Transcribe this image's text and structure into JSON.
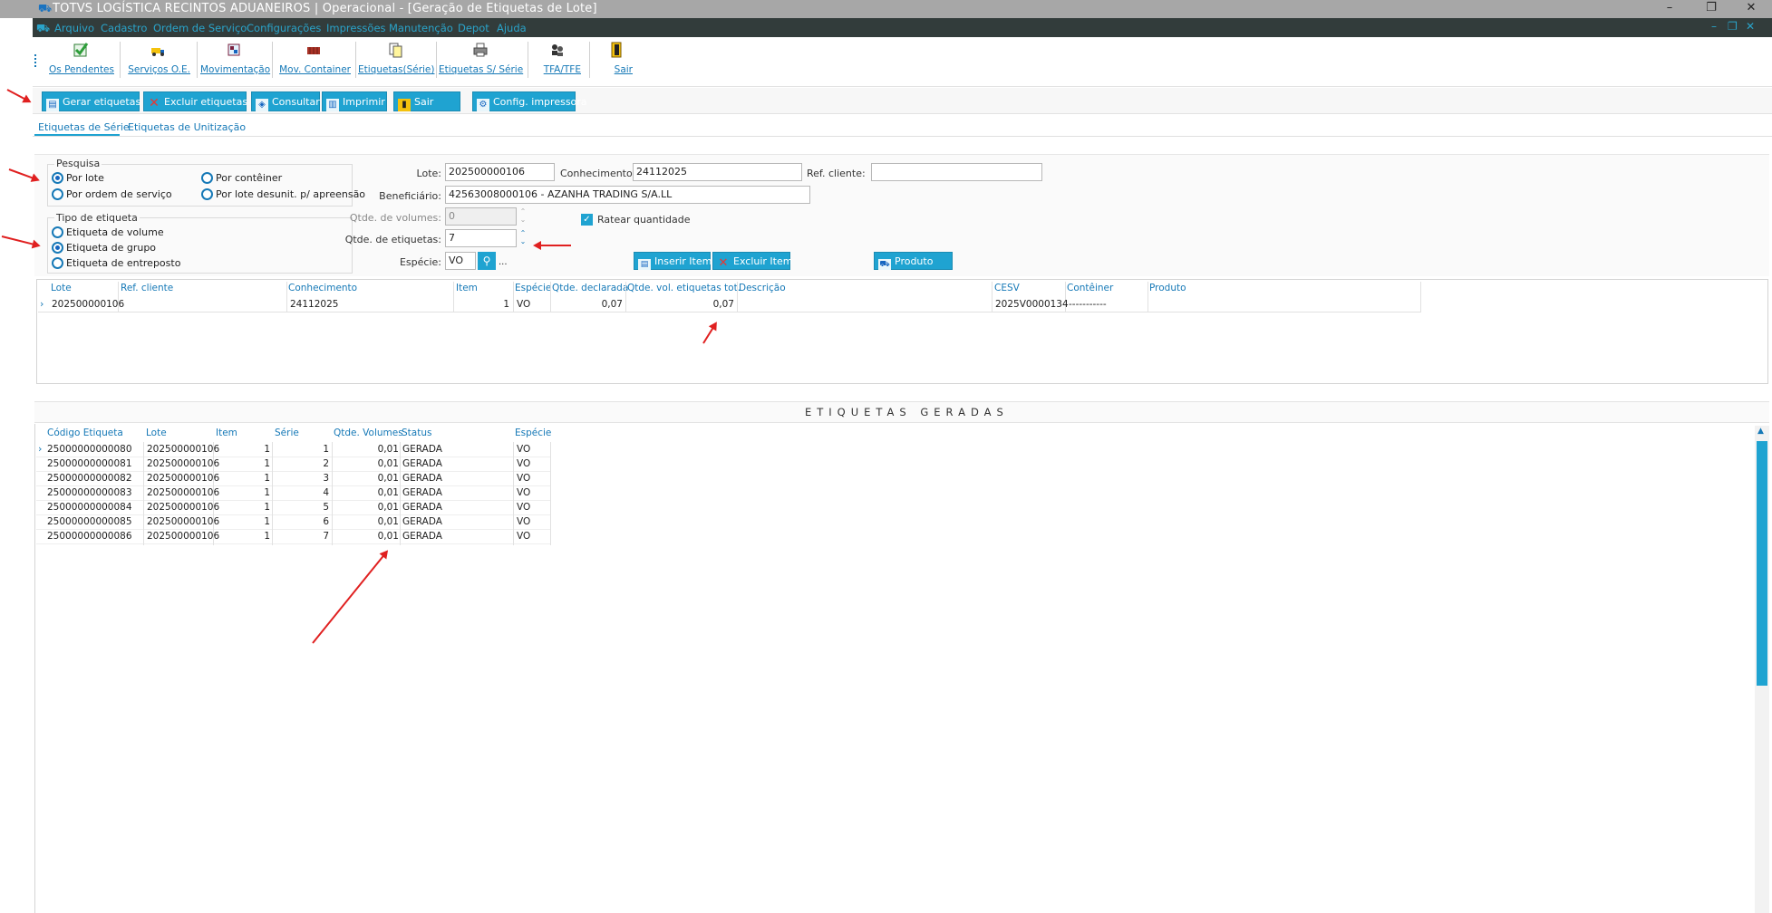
{
  "window": {
    "title": "TOTVS LOGÍSTICA RECINTOS ADUANEIROS | Operacional - [Geração de Etiquetas de Lote]",
    "controls": [
      "–",
      "❐",
      "✕"
    ],
    "mdi_controls": [
      "–",
      "❐",
      "✕"
    ]
  },
  "menu": [
    "Arquivo",
    "Cadastro",
    "Ordem de Serviço",
    "Configurações",
    "Impressões",
    "Manutenção",
    "Depot",
    "Ajuda"
  ],
  "toolbar_main": [
    {
      "label": "Os Pendentes",
      "icon": "check-document-icon"
    },
    {
      "label": "Serviços O.E.",
      "icon": "truck-icon"
    },
    {
      "label": "Movimentação",
      "icon": "movement-icon"
    },
    {
      "label": "Mov. Container",
      "icon": "container-icon"
    },
    {
      "label": "Etiquetas(Série)",
      "icon": "labels-icon"
    },
    {
      "label": "Etiquetas S/ Série",
      "icon": "printer-icon"
    },
    {
      "label": "TFA/TFE",
      "icon": "people-icon"
    },
    {
      "label": "Sair",
      "icon": "exit-door-icon"
    }
  ],
  "toolbar_actions": {
    "gerar": "Gerar etiquetas",
    "excluir": "Excluir etiquetas",
    "consultar": "Consultar",
    "imprimir": "Imprimir",
    "sair": "Sair",
    "config": "Config. impressora"
  },
  "tabs": [
    "Etiquetas de Série",
    "Etiquetas de Unitização"
  ],
  "pesquisa": {
    "title": "Pesquisa",
    "options": [
      {
        "label": "Por lote",
        "checked": true
      },
      {
        "label": "Por contêiner",
        "checked": false
      },
      {
        "label": "Por ordem de serviço",
        "checked": false
      },
      {
        "label": "Por lote desunit. p/ apreensão",
        "checked": false
      }
    ]
  },
  "tipo_etiqueta": {
    "title": "Tipo de etiqueta",
    "options": [
      {
        "label": "Etiqueta de volume",
        "checked": false
      },
      {
        "label": "Etiqueta de grupo",
        "checked": true
      },
      {
        "label": "Etiqueta de entreposto",
        "checked": false
      }
    ]
  },
  "form": {
    "lote_label": "Lote:",
    "lote_value": "202500000106",
    "conhecimento_label": "Conhecimento:",
    "conhecimento_value": "24112025",
    "ref_cliente_label": "Ref. cliente:",
    "ref_cliente_value": "",
    "beneficiario_label": "Beneficiário:",
    "beneficiario_value": "42563008000106 - AZANHA TRADING S/A.LL",
    "qtde_volumes_label": "Qtde. de volumes:",
    "qtde_volumes_value": "0",
    "qtde_etiquetas_label": "Qtde. de etiquetas:",
    "qtde_etiquetas_value": "7",
    "ratear_label": "Ratear quantidade",
    "ratear_checked": true,
    "especie_label": "Espécie:",
    "especie_value": "VO",
    "especie_more": "...",
    "inserir_item": "Inserir Item",
    "excluir_item": "Excluir Item",
    "produto": "Produto"
  },
  "items_grid": {
    "headers": [
      "Lote",
      "Ref. cliente",
      "Conhecimento",
      "Item",
      "Espécie",
      "Qtde. declarada",
      "Qtde. vol. etiquetas tot.",
      "Descrição",
      "CESV",
      "Contêiner",
      "Produto"
    ],
    "rows": [
      [
        "202500000106",
        "",
        "24112025",
        "1",
        "VO",
        "0,07",
        "0,07",
        "",
        "2025V0000134",
        "-----------",
        ""
      ]
    ]
  },
  "generated_section_title": "ETIQUETAS GERADAS",
  "generated_grid": {
    "headers": [
      "Código Etiqueta",
      "Lote",
      "Item",
      "Série",
      "Qtde. Volumes",
      "Status",
      "Espécie"
    ],
    "rows": [
      [
        "25000000000080",
        "202500000106",
        "1",
        "1",
        "0,01",
        "GERADA",
        "VO"
      ],
      [
        "25000000000081",
        "202500000106",
        "1",
        "2",
        "0,01",
        "GERADA",
        "VO"
      ],
      [
        "25000000000082",
        "202500000106",
        "1",
        "3",
        "0,01",
        "GERADA",
        "VO"
      ],
      [
        "25000000000083",
        "202500000106",
        "1",
        "4",
        "0,01",
        "GERADA",
        "VO"
      ],
      [
        "25000000000084",
        "202500000106",
        "1",
        "5",
        "0,01",
        "GERADA",
        "VO"
      ],
      [
        "25000000000085",
        "202500000106",
        "1",
        "6",
        "0,01",
        "GERADA",
        "VO"
      ],
      [
        "25000000000086",
        "202500000106",
        "1",
        "7",
        "0,01",
        "GERADA",
        "VO"
      ]
    ]
  },
  "colors": {
    "accent": "#1fa3d1",
    "link_blue": "#1679b7",
    "menubar": "#323c3b",
    "titlebar": "#a7a7a7",
    "annotation_red": "#e02020"
  }
}
